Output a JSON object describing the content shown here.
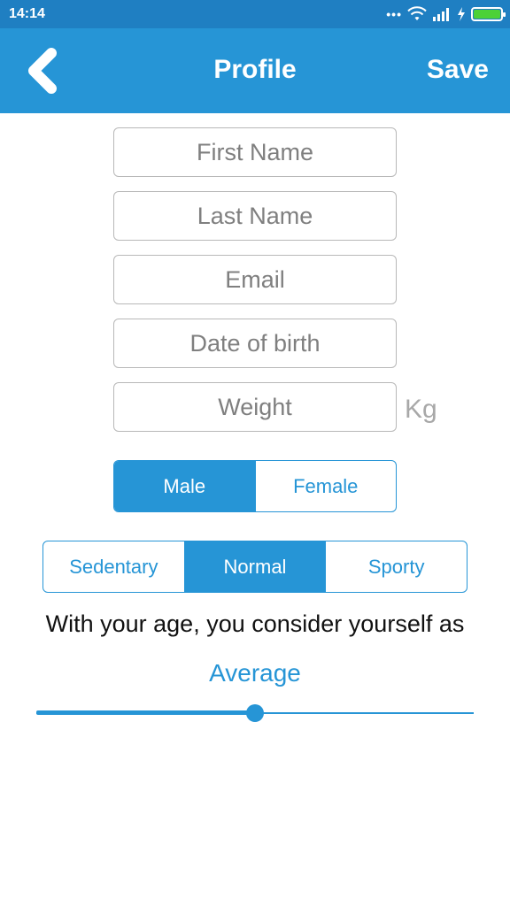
{
  "status_bar": {
    "time": "14:14",
    "icons": [
      "more-dots-icon",
      "wifi-icon",
      "signal-icon",
      "charging-icon",
      "battery-icon"
    ]
  },
  "header": {
    "title": "Profile",
    "save_label": "Save",
    "back_icon": "chevron-left-icon"
  },
  "form": {
    "first_name_placeholder": "First Name",
    "last_name_placeholder": "Last Name",
    "email_placeholder": "Email",
    "dob_placeholder": "Date of birth",
    "weight_placeholder": "Weight",
    "weight_unit": "Kg"
  },
  "gender": {
    "options": [
      "Male",
      "Female"
    ],
    "selected": "Male"
  },
  "activity": {
    "options": [
      "Sedentary",
      "Normal",
      "Sporty"
    ],
    "selected": "Normal"
  },
  "fitness": {
    "question": "With your age, you consider yourself as",
    "value_label": "Average",
    "slider_level": 0.5
  },
  "colors": {
    "accent": "#2695d6",
    "status_bar": "#1f7fc2",
    "battery": "#4cd137"
  }
}
